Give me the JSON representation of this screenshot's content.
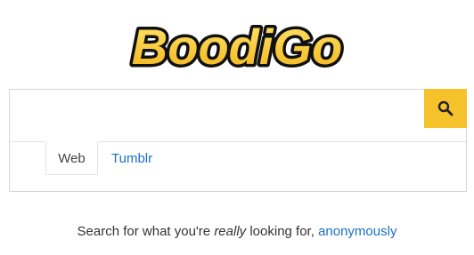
{
  "logo": {
    "text": "BoodiGo",
    "colors": {
      "fill_top": "#ffe56a",
      "fill_bottom": "#f3b51b",
      "outline": "#111111"
    }
  },
  "search": {
    "input_value": "",
    "placeholder": "",
    "button_icon": "search-icon",
    "button_color": "#f5c22b"
  },
  "tabs": [
    {
      "label": "Web",
      "active": true
    },
    {
      "label": "Tumblr",
      "active": false
    }
  ],
  "tagline": {
    "prefix": "Search for what you're ",
    "emphasis": "really",
    "middle": " looking for, ",
    "link": "anonymously"
  },
  "colors": {
    "link": "#1a6fc9",
    "accent": "#f5c22b"
  }
}
